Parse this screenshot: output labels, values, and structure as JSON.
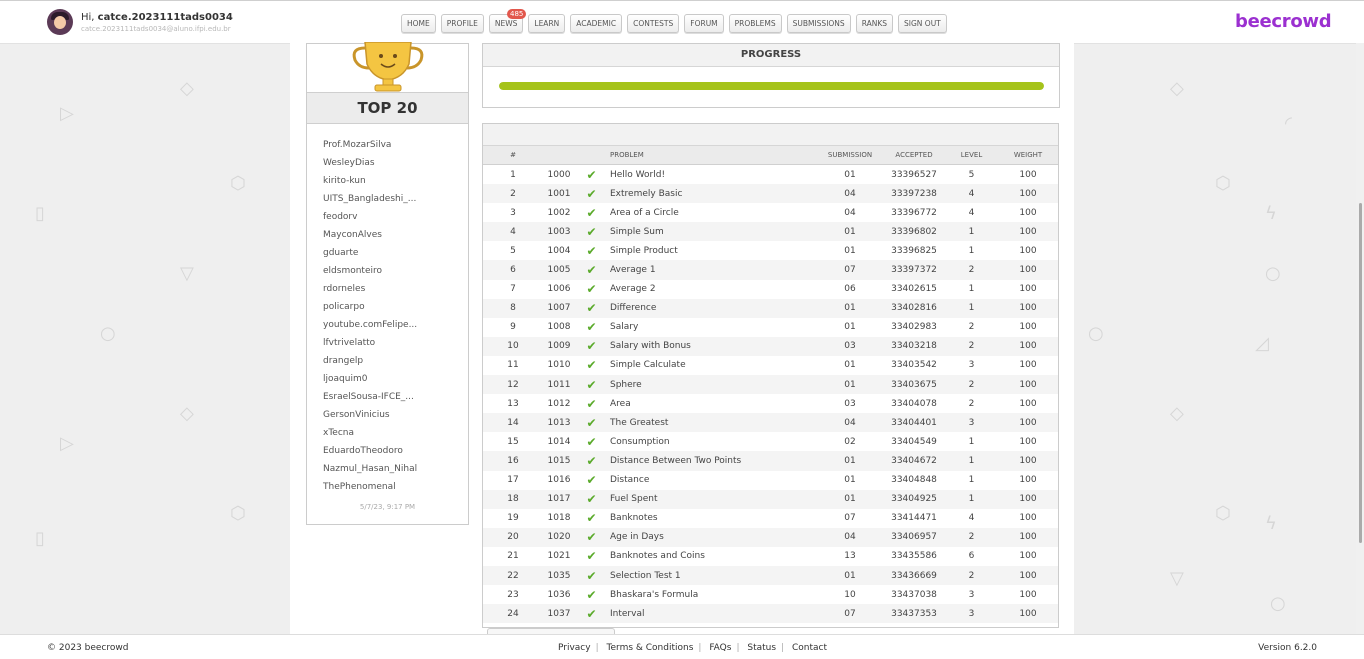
{
  "header": {
    "greeting_prefix": "Hi,",
    "username": "catce.2023111tads0034",
    "email": "catce.2023111tads0034@aluno.ifpi.edu.br",
    "avatar_icon": "user-avatar-icon",
    "logo": "beecrowd",
    "logo_color": "#9b30d0",
    "nav": [
      {
        "label": "HOME"
      },
      {
        "label": "PROFILE"
      },
      {
        "label": "NEWS",
        "badge": "485"
      },
      {
        "label": "LEARN"
      },
      {
        "label": "ACADEMIC"
      },
      {
        "label": "CONTESTS"
      },
      {
        "label": "FORUM"
      },
      {
        "label": "PROBLEMS"
      },
      {
        "label": "SUBMISSIONS"
      },
      {
        "label": "RANKS"
      },
      {
        "label": "SIGN OUT"
      }
    ]
  },
  "sidebar": {
    "title": "TOP 20",
    "trophy_icon": "trophy-icon",
    "users": [
      "Prof.MozarSilva",
      "WesleyDias",
      "kirito-kun",
      "UITS_Bangladeshi_...",
      "feodorv",
      "MayconAlves",
      "gduarte",
      "eldsmonteiro",
      "rdorneles",
      "policarpo",
      "youtube.comFelipe...",
      "lfvtrivelatto",
      "drangelp",
      "ljoaquim0",
      "EsraelSousa-IFCE_...",
      "GersonVinicius",
      "xTecna",
      "EduardoTheodoro",
      "Nazmul_Hasan_Nihal",
      "ThePhenomenal"
    ],
    "date": "5/7/23, 9:17 PM"
  },
  "progress": {
    "title": "PROGRESS",
    "fraction": 1.0,
    "color": "#a5c31a"
  },
  "table": {
    "headers": {
      "index": "#",
      "id": "",
      "status": "",
      "problem": "PROBLEM",
      "submission": "SUBMISSION",
      "accepted": "ACCEPTED",
      "level": "LEVEL",
      "weight": "WEIGHT"
    },
    "status_icon": "check-icon",
    "status_color": "#5aaa2a",
    "rows": [
      [
        "1",
        "1000",
        "Hello World!",
        "01",
        "33396527",
        "5",
        "100"
      ],
      [
        "2",
        "1001",
        "Extremely Basic",
        "04",
        "33397238",
        "4",
        "100"
      ],
      [
        "3",
        "1002",
        "Area of a Circle",
        "04",
        "33396772",
        "4",
        "100"
      ],
      [
        "4",
        "1003",
        "Simple Sum",
        "01",
        "33396802",
        "1",
        "100"
      ],
      [
        "5",
        "1004",
        "Simple Product",
        "01",
        "33396825",
        "1",
        "100"
      ],
      [
        "6",
        "1005",
        "Average 1",
        "07",
        "33397372",
        "2",
        "100"
      ],
      [
        "7",
        "1006",
        "Average 2",
        "06",
        "33402615",
        "1",
        "100"
      ],
      [
        "8",
        "1007",
        "Difference",
        "01",
        "33402816",
        "1",
        "100"
      ],
      [
        "9",
        "1008",
        "Salary",
        "01",
        "33402983",
        "2",
        "100"
      ],
      [
        "10",
        "1009",
        "Salary with Bonus",
        "03",
        "33403218",
        "2",
        "100"
      ],
      [
        "11",
        "1010",
        "Simple Calculate",
        "01",
        "33403542",
        "3",
        "100"
      ],
      [
        "12",
        "1011",
        "Sphere",
        "01",
        "33403675",
        "2",
        "100"
      ],
      [
        "13",
        "1012",
        "Area",
        "03",
        "33404078",
        "2",
        "100"
      ],
      [
        "14",
        "1013",
        "The Greatest",
        "04",
        "33404401",
        "3",
        "100"
      ],
      [
        "15",
        "1014",
        "Consumption",
        "02",
        "33404549",
        "1",
        "100"
      ],
      [
        "16",
        "1015",
        "Distance Between Two Points",
        "01",
        "33404672",
        "1",
        "100"
      ],
      [
        "17",
        "1016",
        "Distance",
        "01",
        "33404848",
        "1",
        "100"
      ],
      [
        "18",
        "1017",
        "Fuel Spent",
        "01",
        "33404925",
        "1",
        "100"
      ],
      [
        "19",
        "1018",
        "Banknotes",
        "07",
        "33414471",
        "4",
        "100"
      ],
      [
        "20",
        "1020",
        "Age in Days",
        "04",
        "33406957",
        "2",
        "100"
      ],
      [
        "21",
        "1021",
        "Banknotes and Coins",
        "13",
        "33435586",
        "6",
        "100"
      ],
      [
        "22",
        "1035",
        "Selection Test 1",
        "01",
        "33436669",
        "2",
        "100"
      ],
      [
        "23",
        "1036",
        "Bhaskara's Formula",
        "10",
        "33437038",
        "3",
        "100"
      ],
      [
        "24",
        "1037",
        "Interval",
        "07",
        "33437353",
        "3",
        "100"
      ]
    ]
  },
  "footer": {
    "copyright": "© 2023 beecrowd",
    "links": [
      "Privacy",
      "Terms & Conditions",
      "FAQs",
      "Status",
      "Contact"
    ],
    "version": "Version 6.2.0"
  }
}
